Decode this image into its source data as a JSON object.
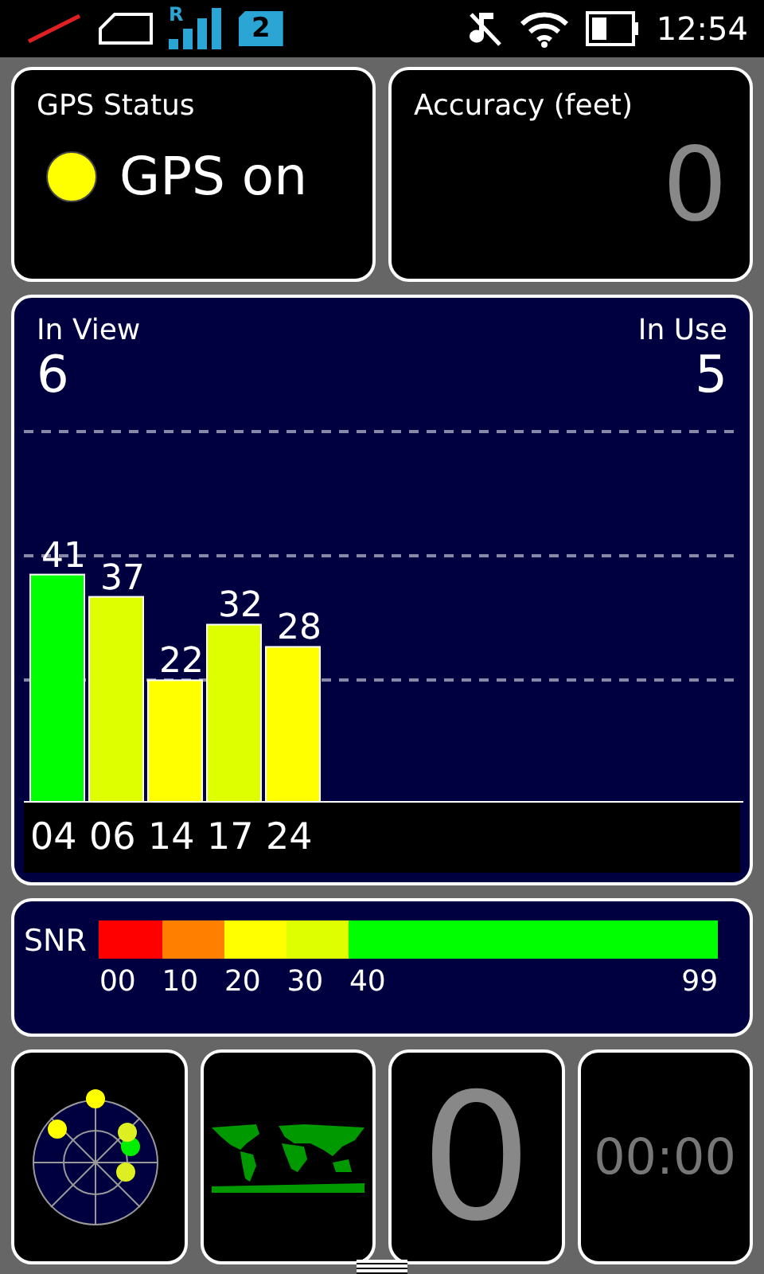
{
  "status_bar": {
    "roaming": "R",
    "sim_badge": "2",
    "time": "12:54"
  },
  "gps_status": {
    "title": "GPS Status",
    "on": true,
    "label": "GPS on"
  },
  "accuracy": {
    "title": "Accuracy (feet)",
    "value": "0"
  },
  "satellites": {
    "in_view_label": "In View",
    "in_view": "6",
    "in_use_label": "In Use",
    "in_use": "5",
    "chart_data": {
      "type": "bar",
      "categories": [
        "04",
        "06",
        "14",
        "17",
        "24"
      ],
      "values": [
        41,
        37,
        22,
        32,
        28
      ],
      "data_labels": true
    }
  },
  "snr": {
    "label": "SNR",
    "scale": [
      {
        "label": "00",
        "color": "#ff0000"
      },
      {
        "label": "10",
        "color": "#ff8000"
      },
      {
        "label": "20",
        "color": "#ffff00"
      },
      {
        "label": "30",
        "color": "#ddff00"
      },
      {
        "label": "40",
        "color": "#00ff00"
      }
    ],
    "max_label": "99"
  },
  "tiles": {
    "speed": "0",
    "elapsed": "00:00"
  }
}
